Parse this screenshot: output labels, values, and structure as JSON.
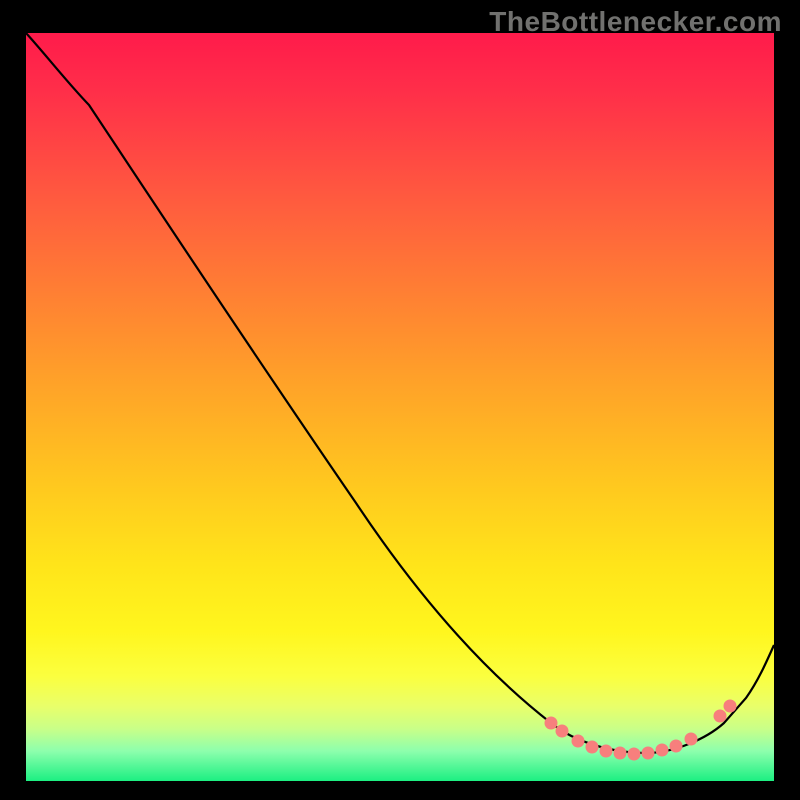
{
  "watermark": "TheBottlenecker.com",
  "chart_data": {
    "type": "line",
    "title": "",
    "xlabel": "",
    "ylabel": "",
    "xlim": [
      0,
      100
    ],
    "ylim": [
      0,
      100
    ],
    "background_gradient": {
      "top_color": "#ff1b4b",
      "mid_color": "#ffe41a",
      "bottom_color": "#1cef82",
      "meaning": "bottleneck severity (red=high, green=low)"
    },
    "series": [
      {
        "name": "bottleneck-curve",
        "color": "#000000",
        "x": [
          0,
          8,
          16,
          28,
          44,
          58,
          70,
          72,
          78,
          83,
          88,
          93,
          96,
          100
        ],
        "y": [
          100,
          90,
          77,
          58,
          37,
          18,
          8,
          7,
          4,
          3.5,
          4,
          8,
          11,
          18
        ]
      }
    ],
    "highlighted_points": {
      "name": "optimal-region-dots",
      "color": "#f77f7d",
      "x": [
        70,
        72,
        74,
        76,
        78,
        79,
        81,
        83,
        85,
        87,
        89,
        93,
        94
      ],
      "y": [
        8,
        7,
        5.5,
        4.6,
        4.1,
        3.8,
        3.6,
        3.8,
        4.2,
        4.7,
        5.6,
        8.6,
        10
      ]
    },
    "annotations": []
  }
}
